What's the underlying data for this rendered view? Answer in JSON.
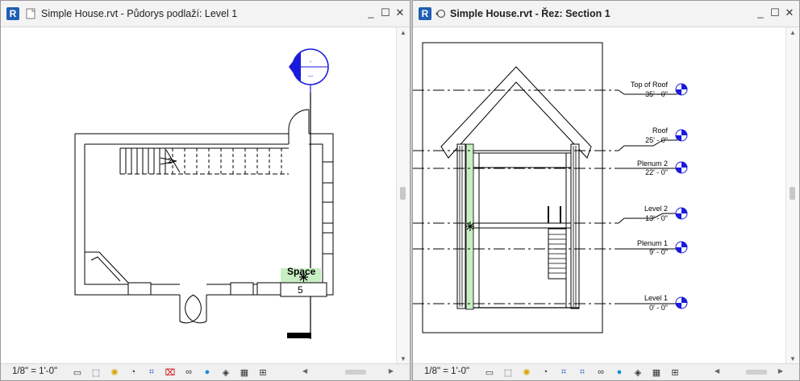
{
  "left_window": {
    "title_prefix": "Simple House.rvt - Půdorys podlaží: ",
    "title_view": "Level 1",
    "scale": "1/8\" = 1'-0\"",
    "space_label": "Space",
    "space_number": "5",
    "stair_tag": "2"
  },
  "right_window": {
    "title": "Simple House.rvt - Řez: Section 1",
    "scale": "1/8\" = 1'-0\"",
    "levels": [
      {
        "name": "Top of Roof",
        "elevation": "35' - 0\""
      },
      {
        "name": "Roof",
        "elevation": "25' - 0\""
      },
      {
        "name": "Plenum 2",
        "elevation": "22' - 0\""
      },
      {
        "name": "Level 2",
        "elevation": "13' - 0\""
      },
      {
        "name": "Plenum 1",
        "elevation": "9' - 0\""
      },
      {
        "name": "Level 1",
        "elevation": "0' - 0\""
      }
    ]
  },
  "app": {
    "logo": "R",
    "min": "_",
    "max": "☐",
    "close": "✕"
  },
  "colors": {
    "section_marker": "#1a1adc",
    "space_fill": "#c8efc4",
    "level_head": "#1a1adc"
  }
}
